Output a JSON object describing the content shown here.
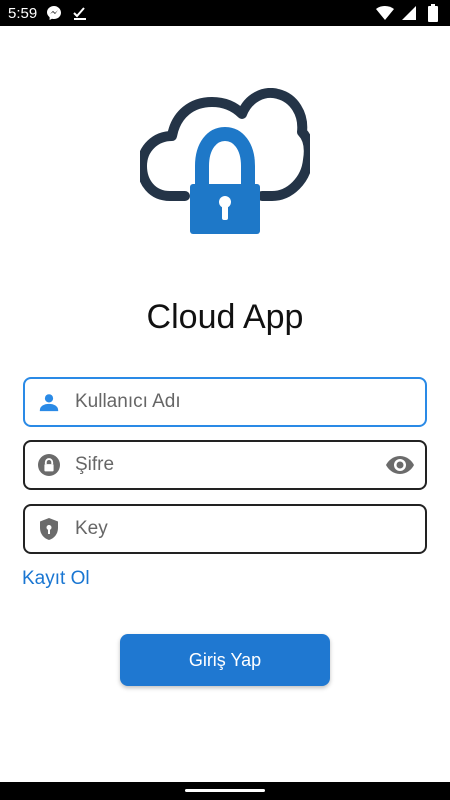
{
  "status_bar": {
    "time": "5:59",
    "icons": [
      "messenger-icon",
      "checkmark-icon",
      "wifi-icon",
      "signal-icon",
      "battery-icon"
    ]
  },
  "logo": {
    "icon": "cloud-lock-icon",
    "cloud_color": "#243447",
    "lock_color": "#1e78c8"
  },
  "app_title": "Cloud App",
  "form": {
    "username": {
      "placeholder": "Kullanıcı Adı",
      "value": "",
      "icon": "person-icon",
      "icon_color": "#2a8ae6",
      "focused": true
    },
    "password": {
      "placeholder": "Şifre",
      "value": "",
      "icon": "lock-icon",
      "trailing_icon": "eye-icon"
    },
    "key": {
      "placeholder": "Key",
      "value": "",
      "icon": "shield-lock-icon"
    }
  },
  "register_link": "Kayıt Ol",
  "login_button": "Giriş Yap",
  "colors": {
    "accent": "#1f78d1",
    "link": "#1976d2",
    "focus_border": "#2a8ae6"
  }
}
